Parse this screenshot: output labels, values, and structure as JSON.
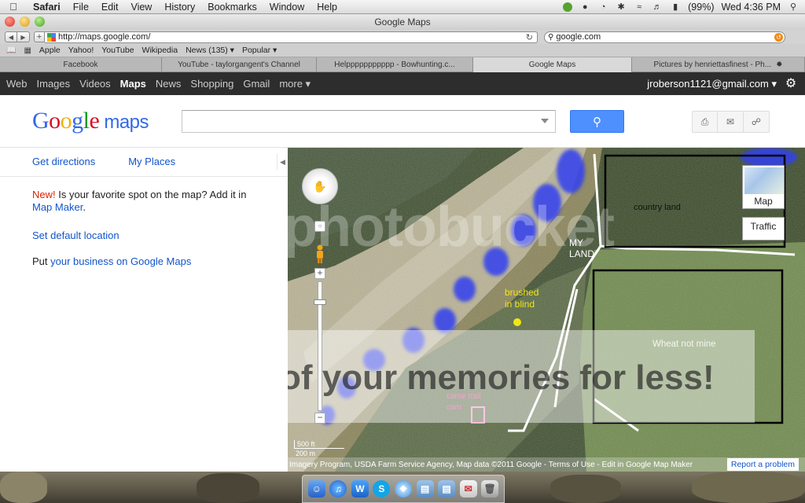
{
  "menubar": {
    "app_name": "Safari",
    "menus": [
      "File",
      "Edit",
      "View",
      "History",
      "Bookmarks",
      "Window",
      "Help"
    ],
    "battery": "(99%)",
    "clock": "Wed 4:36 PM"
  },
  "window": {
    "title": "Google Maps"
  },
  "toolbar": {
    "url": "http://maps.google.com/",
    "search_value": "google.com"
  },
  "bookmarks": [
    "Apple",
    "Yahoo!",
    "YouTube",
    "Wikipedia",
    "News (135) ▾",
    "Popular ▾"
  ],
  "tabs": [
    {
      "label": "Facebook"
    },
    {
      "label": "YouTube - taylorgangent's Channel"
    },
    {
      "label": "Helppppppppppp - Bowhunting.c..."
    },
    {
      "label": "Google Maps"
    },
    {
      "label": "Pictures by henriettasfinest - Ph..."
    }
  ],
  "googlebar": {
    "links": [
      "Web",
      "Images",
      "Videos",
      "Maps",
      "News",
      "Shopping",
      "Gmail",
      "more ▾"
    ],
    "active": "Maps",
    "user": "jroberson1121@gmail.com ▾"
  },
  "maps_header": {
    "logo_word": "Google",
    "logo_suffix": "maps",
    "search_value": "",
    "search_button_icon": "magnifier-icon"
  },
  "sidebar": {
    "get_directions": "Get directions",
    "my_places": "My Places",
    "new_label": "New!",
    "promo_text": " Is your favorite spot on the map? Add it in ",
    "promo_link": "Map Maker",
    "promo_end": ".",
    "default_location": "Set default location",
    "business_prefix": "Put ",
    "business_link": "your business on Google Maps"
  },
  "map": {
    "map_button": "Map",
    "traffic_button": "Traffic",
    "scale": "500 ft",
    "scale_sub": "200 m",
    "attribution": "Imagery Program, USDA Farm Service Agency, Map data ©2011 Google - Terms of Use - Edit in Google Map Maker",
    "report_problem": "Report a problem",
    "watermark": "photobucket",
    "promo_overlay": "of your memories for less!",
    "annotations": {
      "country_land": "country land",
      "my_land_1": "MY",
      "my_land_2": "LAND",
      "brushed_1": "brushed",
      "brushed_2": "in blind",
      "wheat": "Wheat not mine",
      "camera_1": "came trail",
      "camera_2": "cam"
    },
    "colors": {
      "annotation_yellow": "#f1e616",
      "annotation_blue": "#3040f0",
      "annotation_pink": "#ff9dd1"
    }
  }
}
